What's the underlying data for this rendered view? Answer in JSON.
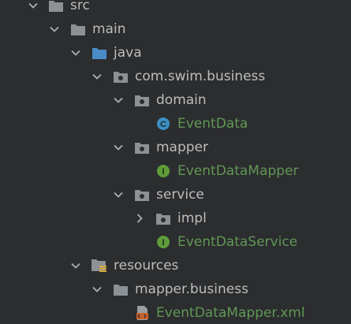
{
  "colors": {
    "background": "#2b2d2f",
    "text": "#bdbdbd",
    "source_file_text": "#629755",
    "folder": "#8c9195",
    "source_folder": "#4a8cc7",
    "class_icon": "#3d8fc4",
    "interface_icon": "#5e9c3a"
  },
  "tree": {
    "src": {
      "label": "src",
      "icon": "folder-icon",
      "expanded": true
    },
    "main": {
      "label": "main",
      "icon": "folder-icon",
      "expanded": true
    },
    "java": {
      "label": "java",
      "icon": "source-folder-icon",
      "expanded": true
    },
    "package_root": {
      "label": "com.swim.business",
      "icon": "package-icon",
      "expanded": true
    },
    "domain": {
      "label": "domain",
      "icon": "package-icon",
      "expanded": true
    },
    "event_data": {
      "label": "EventData",
      "icon": "class-icon",
      "badge": "C"
    },
    "mapper": {
      "label": "mapper",
      "icon": "package-icon",
      "expanded": true
    },
    "event_data_mapper": {
      "label": "EventDataMapper",
      "icon": "interface-icon",
      "badge": "I"
    },
    "service": {
      "label": "service",
      "icon": "package-icon",
      "expanded": true
    },
    "impl": {
      "label": "impl",
      "icon": "package-icon",
      "expanded": false
    },
    "event_data_service": {
      "label": "EventDataService",
      "icon": "interface-icon",
      "badge": "I"
    },
    "resources": {
      "label": "resources",
      "icon": "resources-folder-icon",
      "expanded": true
    },
    "mapper_business": {
      "label": "mapper.business",
      "icon": "folder-icon",
      "expanded": true
    },
    "event_data_mapper_xml": {
      "label": "EventDataMapper.xml",
      "icon": "xml-file-icon"
    }
  }
}
